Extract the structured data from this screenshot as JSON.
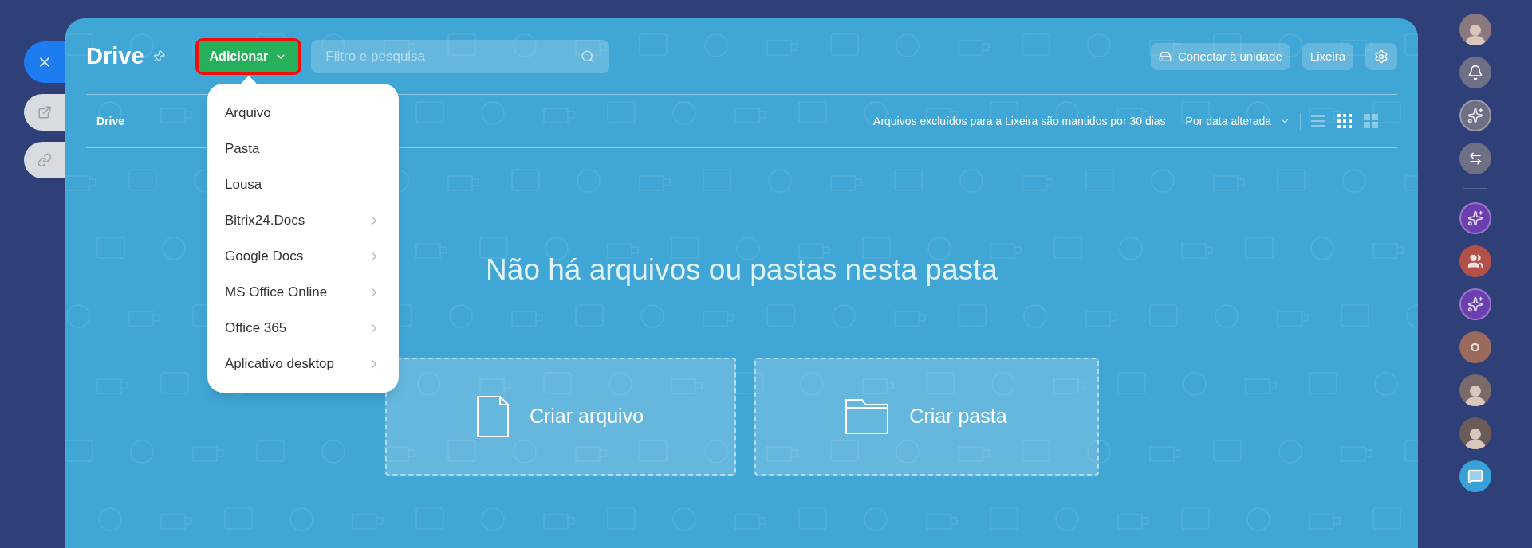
{
  "header": {
    "title": "Drive",
    "add_button": "Adicionar",
    "search": {
      "placeholder": "Filtro e pesquisa"
    },
    "connect_button": "Conectar à unidade",
    "trash_button": "Lixeira"
  },
  "toolbar": {
    "breadcrumb": "Drive",
    "notice": "Arquivos excluídos para a Lixeira são mantidos por 30 dias",
    "sort": "Por data alterada",
    "views": [
      {
        "kind": "list",
        "selected": false
      },
      {
        "kind": "grid",
        "selected": true
      },
      {
        "kind": "tiles",
        "selected": false
      }
    ]
  },
  "add_menu": {
    "items": [
      {
        "label": "Arquivo",
        "submenu": false
      },
      {
        "label": "Pasta",
        "submenu": false
      },
      {
        "label": "Lousa",
        "submenu": false
      },
      {
        "label": "Bitrix24.Docs",
        "submenu": true
      },
      {
        "label": "Google Docs",
        "submenu": true
      },
      {
        "label": "MS Office Online",
        "submenu": true
      },
      {
        "label": "Office 365",
        "submenu": true
      },
      {
        "label": "Aplicativo desktop",
        "submenu": true
      }
    ]
  },
  "empty": {
    "message": "Não há arquivos ou pastas nesta pasta",
    "actions": [
      {
        "kind": "file",
        "label": "Criar arquivo"
      },
      {
        "kind": "folder",
        "label": "Criar pasta"
      }
    ]
  },
  "right_bar": {
    "items": [
      {
        "kind": "avatar",
        "color": "#8a7a80"
      },
      {
        "kind": "bell",
        "color": "#6f6f86"
      },
      {
        "kind": "copilot",
        "color": "#6f6f86"
      },
      {
        "kind": "chat-swap",
        "color": "#6f6f86"
      },
      {
        "kind": "divider"
      },
      {
        "kind": "copilot",
        "color": "#6b3fb0"
      },
      {
        "kind": "group",
        "color": "#b4504a"
      },
      {
        "kind": "copilot",
        "color": "#6b3fb0"
      },
      {
        "kind": "letter",
        "color": "#9a6a5c",
        "text": "O"
      },
      {
        "kind": "avatar",
        "color": "#7a6a6a"
      },
      {
        "kind": "avatar",
        "color": "#6a5a5a"
      },
      {
        "kind": "chat",
        "color": "#3aa0d8"
      }
    ]
  }
}
